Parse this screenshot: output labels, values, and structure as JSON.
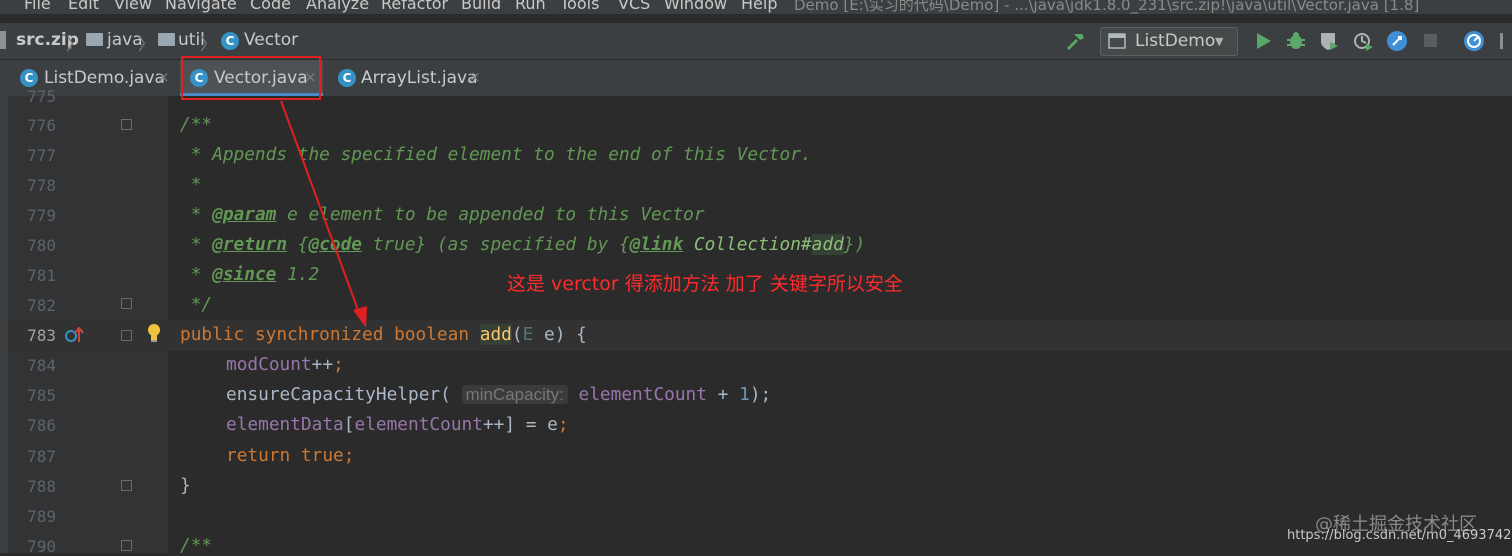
{
  "menu": [
    "File",
    "Edit",
    "View",
    "Navigate",
    "Code",
    "Analyze",
    "Refactor",
    "Build",
    "Run",
    "Tools",
    "VCS",
    "Window",
    "Help"
  ],
  "window_title": "Demo [E:\\实习的代码\\Demo] - ...\\java\\jdk1.8.0_231\\src.zip!\\java\\util\\Vector.java [1.8]",
  "breadcrumb": {
    "root": "src.zip",
    "pkg1": "java",
    "pkg2": "util",
    "cls": "Vector",
    "sep": "〉"
  },
  "run_config": {
    "label": "ListDemo",
    "arrow": "▼"
  },
  "tabs": [
    {
      "label": "ListDemo.java",
      "close": "×"
    },
    {
      "label": "Vector.java",
      "close": "×"
    },
    {
      "label": "ArrayList.java",
      "close": "×"
    }
  ],
  "class_icon_glyph": "C",
  "lines": [
    "775",
    "776",
    "777",
    "778",
    "779",
    "780",
    "781",
    "782",
    "783",
    "784",
    "785",
    "786",
    "787",
    "788",
    "789",
    "790"
  ],
  "code": {
    "l776": "/**",
    "l777": " * Appends the specified element to the end of this Vector.",
    "l778": " *",
    "l779_a": " * ",
    "l779_tag": "@param",
    "l779_b": " e element to be appended to this Vector",
    "l780_a": " * ",
    "l780_tag": "@return",
    "l780_b": " {",
    "l780_tag2": "@code",
    "l780_c": " true} (as specified by {",
    "l780_tag3": "@link",
    "l780_d": " Collection#",
    "l780_e": "add",
    "l780_f": "})",
    "l781_a": " * ",
    "l781_tag": "@since",
    "l781_b": " 1.2",
    "l782": " */",
    "l783_kw": "public synchronized boolean ",
    "l783_fn": "add",
    "l783_p": "(",
    "l783_t": "E",
    "l783_rest": " e) {",
    "l784_f": "modCount",
    "l784_r": "++",
    "l784_s": ";",
    "l785_a": "ensureCapacityHelper(",
    "l785_hint": "minCapacity:",
    "l785_f": " elementCount",
    "l785_op": " + ",
    "l785_n": "1",
    "l785_e": ");",
    "l786_f1": "elementData",
    "l786_b": "[",
    "l786_f2": "elementCount",
    "l786_c": "++] = e",
    "l786_s": ";",
    "l787": "return true;",
    "l788": "}",
    "l790": "/**"
  },
  "annotation": "这是 verctor 得添加方法 加了  关键字所以安全",
  "watermark": {
    "line1": "@稀土掘金技术社区",
    "line2": "https://blog.csdn.net/m0_46937429"
  },
  "colors": {
    "accent": "#4a88c7",
    "annotation": "#ff2b2b",
    "keyword": "#cc7832",
    "doc": "#629755"
  }
}
